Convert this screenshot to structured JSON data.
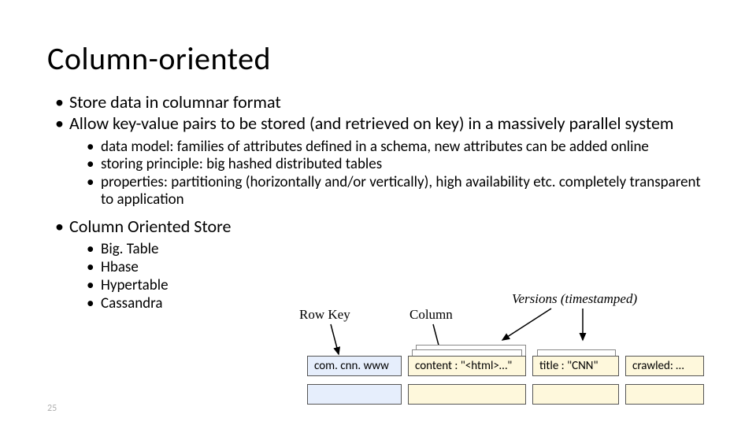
{
  "title": "Column-oriented",
  "bullets": {
    "b1": "Store data in columnar format",
    "b2": "Allow key-value pairs to be stored (and retrieved on key) in a massively parallel system",
    "b2_sub": {
      "s1": "data model: families of attributes defined in a schema, new attributes can be added online",
      "s2": "storing principle: big hashed distributed tables",
      "s3": "properties: partitioning (horizontally and/or vertically), high availability etc. completely transparent to application"
    },
    "b3": "Column Oriented Store",
    "b3_sub": {
      "s1": "Big. Table",
      "s2": "Hbase",
      "s3": "Hypertable",
      "s4": "Cassandra"
    }
  },
  "diagram": {
    "labels": {
      "row_key": "Row Key",
      "column": "Column",
      "versions": "Versions (timestamped)"
    },
    "boxes": {
      "rowkey1": "com. cnn. www",
      "col1": "content : \"<html>…\"",
      "col2": "title : \"CNN\"",
      "col3": "crawled: …"
    }
  },
  "page_number": "25"
}
